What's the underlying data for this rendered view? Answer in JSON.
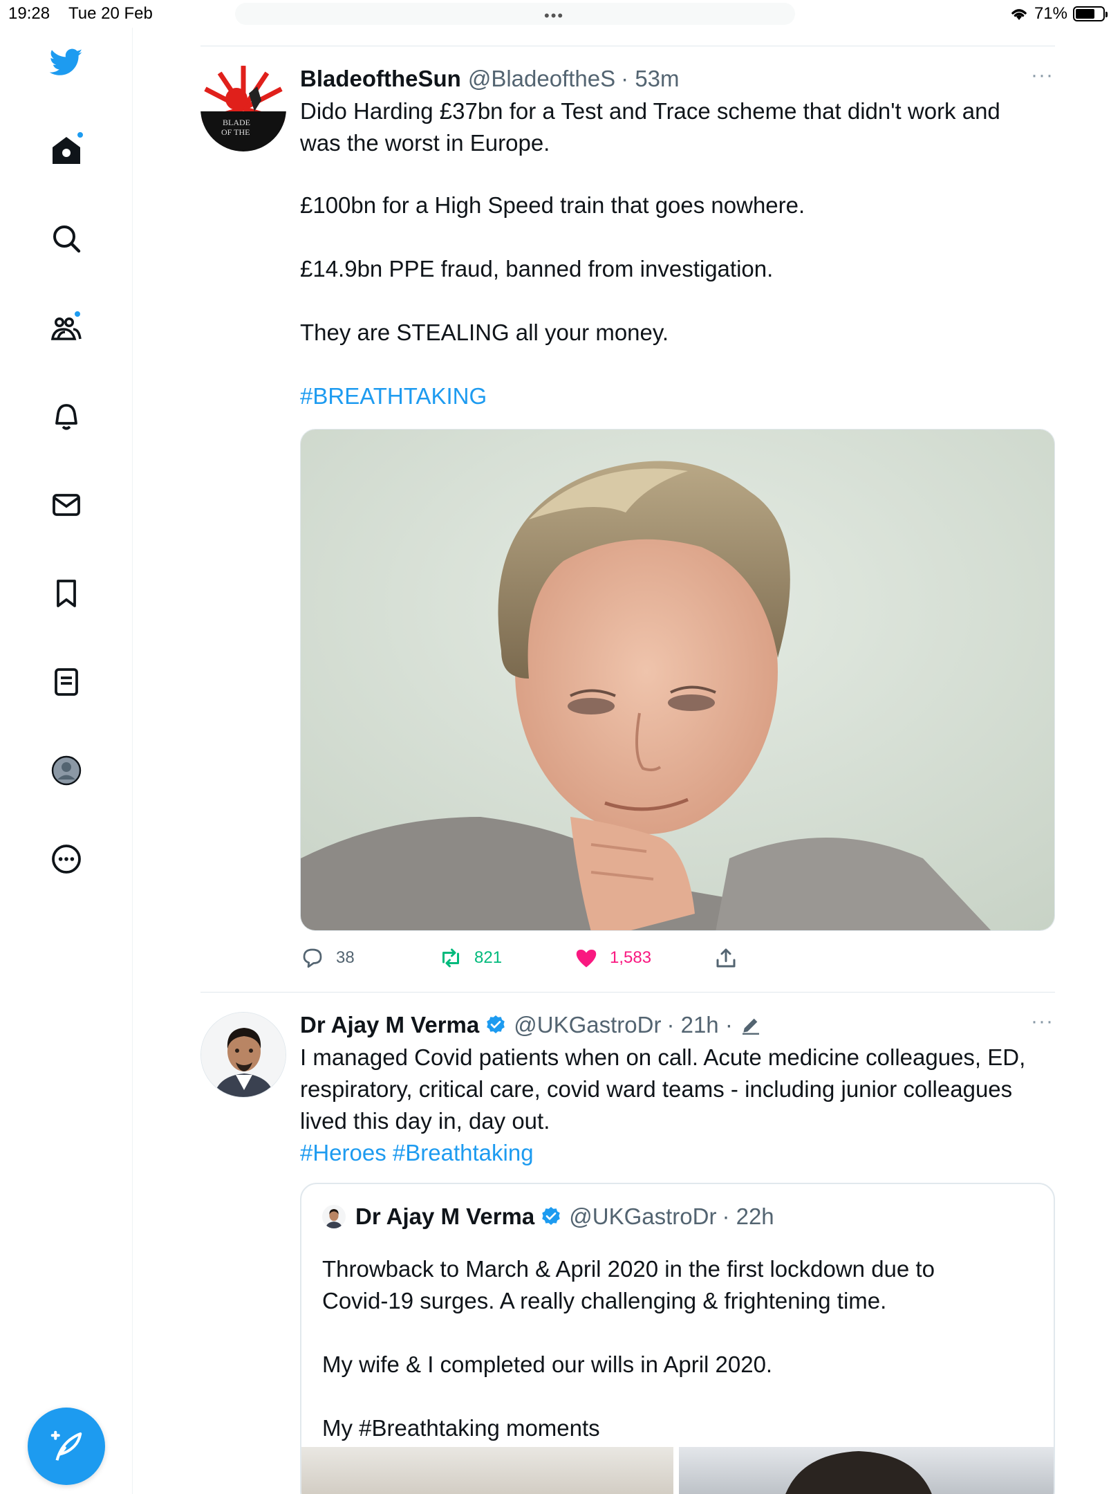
{
  "status_bar": {
    "time": "19:28",
    "date": "Tue 20 Feb",
    "battery": "71%",
    "battery_level": 0.71
  },
  "sidebar": {
    "items": [
      {
        "icon": "twitter-logo-icon",
        "label": "Twitter"
      },
      {
        "icon": "home-icon",
        "label": "Home"
      },
      {
        "icon": "search-icon",
        "label": "Search"
      },
      {
        "icon": "communities-icon",
        "label": "Communities"
      },
      {
        "icon": "bell-icon",
        "label": "Notifications"
      },
      {
        "icon": "mail-icon",
        "label": "Messages"
      },
      {
        "icon": "bookmark-icon",
        "label": "Bookmarks"
      },
      {
        "icon": "lists-icon",
        "label": "Lists"
      },
      {
        "icon": "profile-icon",
        "label": "Profile"
      },
      {
        "icon": "more-circle-icon",
        "label": "More"
      }
    ],
    "compose_icon": "compose-feather-icon"
  },
  "tweets": [
    {
      "name": "BladeoftheSun",
      "handle": "@BladeoftheS",
      "time": "· 53m",
      "more": "···",
      "avatar_caption": "BLADE OF THE",
      "lines": [
        "Dido Harding £37bn for a Test and Trace scheme that didn't work and",
        "was the worst in Europe.",
        "£100bn for a High Speed train that goes nowhere.",
        "£14.9bn PPE fraud, banned from investigation.",
        "They are STEALING all your money."
      ],
      "hashtag": "#BREATHTAKING",
      "stats": {
        "replies": "38",
        "retweets": "821",
        "likes": "1,583"
      }
    },
    {
      "name": "Dr Ajay M Verma",
      "handle": "@UKGastroDr",
      "time": "· 21h ·",
      "more": "···",
      "text": "I managed Covid patients when on call. Acute medicine colleagues, ED,\nrespiratory, critical care, covid ward teams - including junior colleagues\nlived this day in, day out.",
      "hashtags": "#Heroes #Breathtaking",
      "quote": {
        "name": "Dr Ajay M Verma",
        "handle": "@UKGastroDr",
        "time": "· 22h",
        "text": "Throwback to March & April 2020 in the first lockdown due to\nCovid-19 surges. A really challenging & frightening time.\n\nMy wife & I completed our wills in April 2020.\n\nMy #Breathtaking moments"
      }
    }
  ],
  "colors": {
    "accent": "#1d9bf0",
    "retweet": "#00ba7c",
    "like": "#f91880",
    "muted": "#536471"
  }
}
